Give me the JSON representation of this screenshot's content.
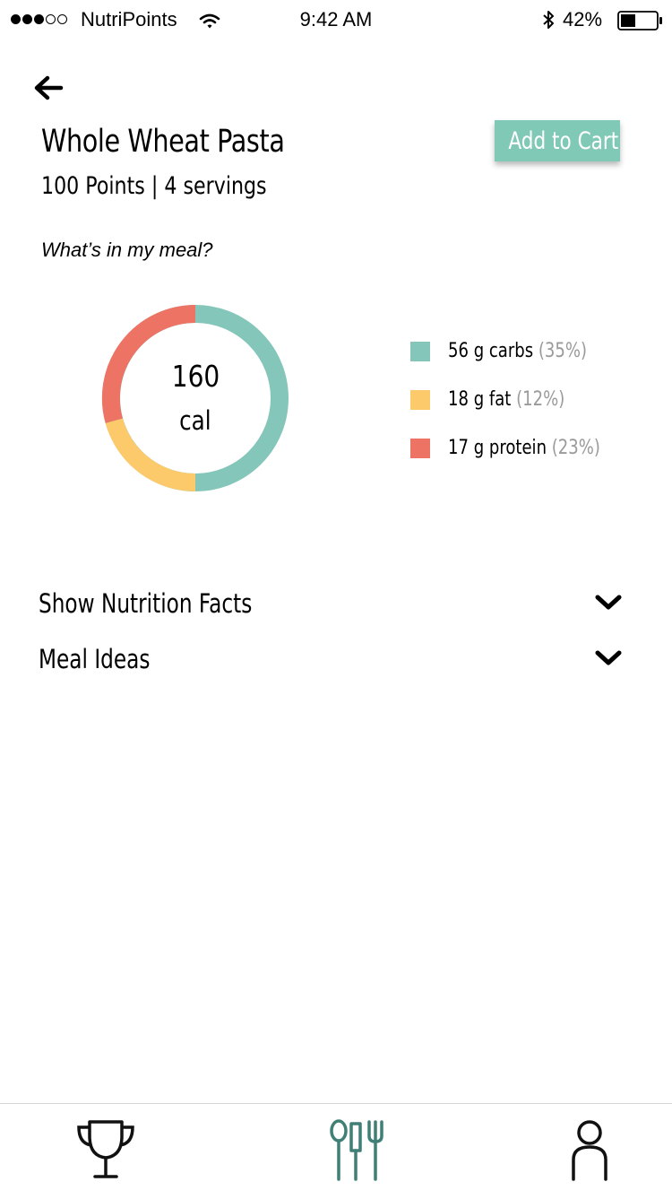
{
  "status_bar": {
    "carrier": "NutriPoints",
    "time": "9:42 AM",
    "battery": "42%",
    "battery_level": 0.42,
    "signal_filled": 3,
    "signal_total": 5
  },
  "product": {
    "name": "Whole Wheat Pasta",
    "details": "100 Points | 4 servings"
  },
  "actions": {
    "add_to_cart": "Add to Cart"
  },
  "meal_question": "What’s in my meal?",
  "nutrition": {
    "calories": "160",
    "calories_unit": "cal",
    "macros": [
      {
        "label": "56 g carbs",
        "percent": "(35%)",
        "color": "#84c6b9"
      },
      {
        "label": "18 g fat",
        "percent": "(12%)",
        "color": "#fdca6b"
      },
      {
        "label": "17 g protein",
        "percent": "(23%)",
        "color": "#ed7364"
      }
    ]
  },
  "sections": [
    {
      "label": "Show Nutrition Facts"
    },
    {
      "label": "Meal Ideas"
    }
  ],
  "tabs": [
    {
      "icon": "trophy-icon"
    },
    {
      "icon": "utensils-icon",
      "active": true
    },
    {
      "icon": "person-icon"
    }
  ],
  "colors": {
    "accent": "#80c9b6",
    "tab_active": "#3f7f75",
    "muted": "#9a9a9a"
  }
}
